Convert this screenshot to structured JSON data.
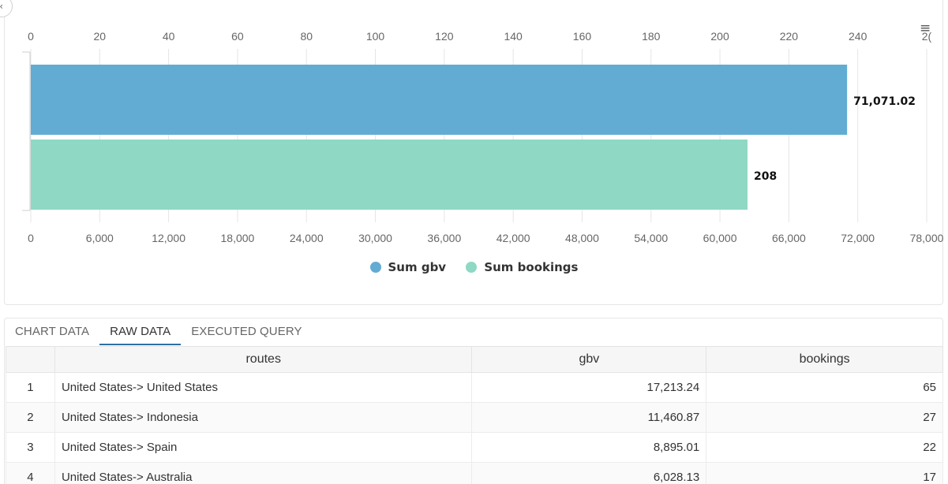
{
  "colors": {
    "gbv": "#62acd4",
    "bookings": "#8fd8c4",
    "grid": "#e5e5e5",
    "tab_active": "#2f6fa5"
  },
  "chart_data": {
    "type": "bar",
    "orientation": "horizontal",
    "series": [
      {
        "name": "Sum gbv",
        "value": 71071.02,
        "label": "71,071.02",
        "axis": "bottom"
      },
      {
        "name": "Sum bookings",
        "value": 208,
        "label": "208",
        "axis": "top"
      }
    ],
    "top_axis": {
      "min": 0,
      "max": 260,
      "ticks": [
        "0",
        "20",
        "40",
        "60",
        "80",
        "100",
        "120",
        "140",
        "160",
        "180",
        "200",
        "220",
        "240",
        "2("
      ]
    },
    "bottom_axis": {
      "min": 0,
      "max": 78000,
      "ticks": [
        "0",
        "6,000",
        "12,000",
        "18,000",
        "24,000",
        "30,000",
        "36,000",
        "42,000",
        "48,000",
        "54,000",
        "60,000",
        "66,000",
        "72,000",
        "78,000"
      ]
    },
    "grid": true,
    "legend_position": "bottom-center"
  },
  "legend": [
    {
      "label": "Sum gbv",
      "color": "#62acd4"
    },
    {
      "label": "Sum bookings",
      "color": "#8fd8c4"
    }
  ],
  "icons": {
    "back": "chevron-left-icon",
    "menu": "hamburger-menu-icon"
  },
  "tabs": [
    {
      "label": "CHART DATA",
      "active": false
    },
    {
      "label": "RAW DATA",
      "active": true
    },
    {
      "label": "EXECUTED QUERY",
      "active": false
    }
  ],
  "table": {
    "headers": [
      "",
      "routes",
      "gbv",
      "bookings"
    ],
    "rows": [
      [
        "1",
        "United States-> United States",
        "17,213.24",
        "65"
      ],
      [
        "2",
        "United States-> Indonesia",
        "11,460.87",
        "27"
      ],
      [
        "3",
        "United States-> Spain",
        "8,895.01",
        "22"
      ],
      [
        "4",
        "United States-> Australia",
        "6,028.13",
        "17"
      ]
    ]
  }
}
